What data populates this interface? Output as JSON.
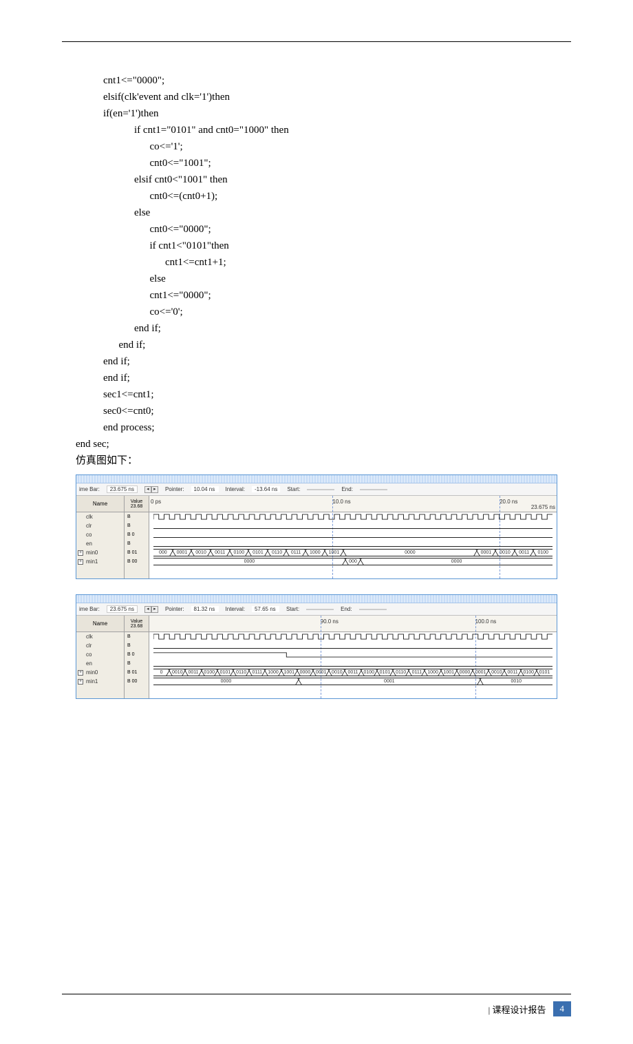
{
  "code": {
    "l1": "cnt1<=\"0000\";",
    "l2": "elsif(clk'event and clk='1')then",
    "l3": "if(en='1')then",
    "l4": "if cnt1=\"0101\" and cnt0=\"1000\" then",
    "l5": "co<='1';",
    "l6": "cnt0<=\"1001\";",
    "l7": "elsif cnt0<\"1001\" then",
    "l8": "cnt0<=(cnt0+1);",
    "l9": "else",
    "l10": "cnt0<=\"0000\";",
    "l11": "if cnt1<\"0101\"then",
    "l12": "cnt1<=cnt1+1;",
    "l13": "else",
    "l14": "cnt1<=\"0000\";",
    "l15": "co<='0';",
    "l16": "end if;",
    "l17": "end if;",
    "l18": "end if;",
    "l19": "end if;",
    "l20": "sec1<=cnt1;",
    "l21": "sec0<=cnt0;",
    "l22": "end process;",
    "l23": "end sec;",
    "l24": "仿真图如下："
  },
  "sim1": {
    "toolbar": {
      "timebar_label": "ime Bar:",
      "timebar_val": "23.675 ns",
      "pointer_label": "Pointer:",
      "pointer_val": "10.04 ns",
      "interval_label": "Interval:",
      "interval_val": "-13.64 ns",
      "start_label": "Start:",
      "start_val": "",
      "end_label": "End:",
      "end_val": ""
    },
    "name_header": "Name",
    "value_header_top": "Value",
    "value_header_bot": "23.68",
    "ruler": {
      "t0": "0 ps",
      "t1": "10.0 ns",
      "t2": "20.0 ns",
      "t3": "23.675 ns"
    },
    "signals": [
      {
        "name": "clk",
        "val": "B"
      },
      {
        "name": "clr",
        "val": "B"
      },
      {
        "name": "co",
        "val": "B 0"
      },
      {
        "name": "en",
        "val": "B"
      },
      {
        "name": "min0",
        "val": "B 01",
        "expand": true
      },
      {
        "name": "min1",
        "val": "B 00",
        "expand": true
      }
    ],
    "min0_seq": [
      "000",
      "0001",
      "0010",
      "0011",
      "0100",
      "0101",
      "0110",
      "0111",
      "1000",
      "1001"
    ],
    "min0_mid": "0000",
    "min0_tail": [
      "0001",
      "0010",
      "0011",
      "0100"
    ],
    "min1_left": "0000",
    "min1_mid": "000",
    "min1_right": "0000"
  },
  "sim2": {
    "toolbar": {
      "timebar_label": "ime Bar:",
      "timebar_val": "23.675 ns",
      "pointer_label": "Pointer:",
      "pointer_val": "81.32 ns",
      "interval_label": "Interval:",
      "interval_val": "57.65 ns",
      "start_label": "Start:",
      "start_val": "",
      "end_label": "End:",
      "end_val": ""
    },
    "name_header": "Name",
    "value_header_top": "Value",
    "value_header_bot": "23.68",
    "ruler": {
      "t0": "90.0 ns",
      "t1": "100.0 ns"
    },
    "signals": [
      {
        "name": "clk",
        "val": "B"
      },
      {
        "name": "clr",
        "val": "B"
      },
      {
        "name": "co",
        "val": "B 0"
      },
      {
        "name": "en",
        "val": "B"
      },
      {
        "name": "min0",
        "val": "B 01",
        "expand": true
      },
      {
        "name": "min1",
        "val": "B 00",
        "expand": true
      }
    ],
    "min0_seq": [
      "0",
      "0010",
      "0011",
      "0100",
      "0101",
      "0110",
      "0111",
      "1000",
      "1001",
      "0000",
      "0001",
      "0010",
      "0011",
      "0100",
      "0101",
      "0110",
      "0111",
      "1000",
      "1001",
      "0000",
      "0001",
      "0010",
      "0011",
      "0100",
      "0101"
    ],
    "min1_seq": [
      "0000",
      "0001",
      "0010"
    ]
  },
  "footer": {
    "label": "| 课程设计报告",
    "page": "4"
  }
}
